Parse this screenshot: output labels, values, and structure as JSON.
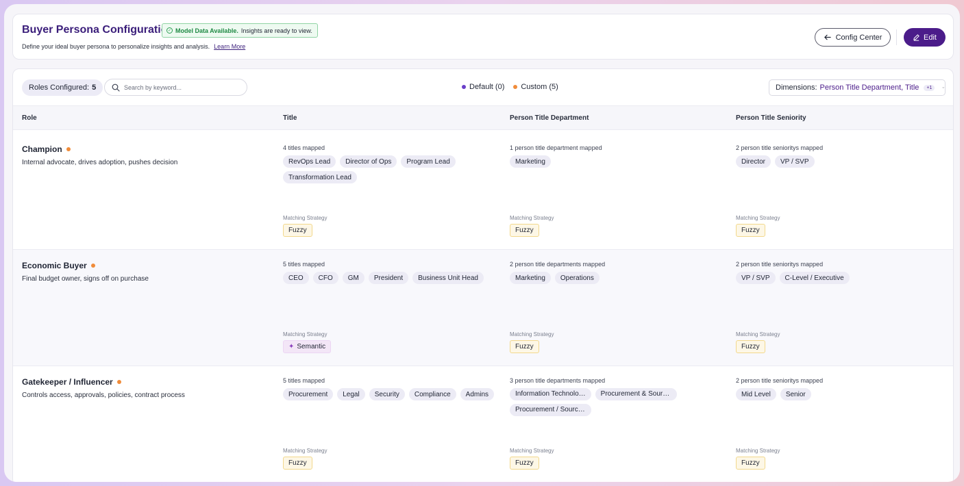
{
  "header": {
    "title": "Buyer Persona Configuration",
    "status_strong": "Model Data Available.",
    "status_text": "Insights are ready to view.",
    "subtitle": "Define your ideal buyer persona to personalize insights and analysis.",
    "learn_more": "Learn More",
    "config_center_label": "Config Center",
    "edit_label": "Edit"
  },
  "toolbar": {
    "roles_label": "Roles Configured:",
    "roles_count": "5",
    "search_placeholder": "Search by keyword...",
    "legend_default": "Default (0)",
    "legend_custom": "Custom (5)",
    "dimensions_label": "Dimensions:",
    "dimensions_value": "Person Title Department, Title",
    "dimensions_extra": "+1"
  },
  "columns": [
    "Role",
    "Title",
    "Person Title Department",
    "Person Title Seniority"
  ],
  "strategy_caption": "Matching Strategy",
  "rows": [
    {
      "name": "Champion",
      "desc": "Internal advocate, drives adoption, pushes decision",
      "title_caption": "4 titles mapped",
      "titles": [
        "RevOps Lead",
        "Director of Ops",
        "Program Lead",
        "Transformation Lead"
      ],
      "title_strategy": "Fuzzy",
      "dept_caption": "1 person title department mapped",
      "depts": [
        "Marketing"
      ],
      "dept_strategy": "Fuzzy",
      "sen_caption": "2 person title senioritys mapped",
      "seniorities": [
        "Director",
        "VP / SVP"
      ],
      "sen_strategy": "Fuzzy"
    },
    {
      "name": "Economic Buyer",
      "desc": "Final budget owner, signs off on purchase",
      "title_caption": "5 titles mapped",
      "titles": [
        "CEO",
        "CFO",
        "GM",
        "President",
        "Business Unit Head"
      ],
      "title_strategy": "Semantic",
      "dept_caption": "2 person title departments mapped",
      "depts": [
        "Marketing",
        "Operations"
      ],
      "dept_strategy": "Fuzzy",
      "sen_caption": "2 person title senioritys mapped",
      "seniorities": [
        "VP / SVP",
        "C-Level / Executive"
      ],
      "sen_strategy": "Fuzzy"
    },
    {
      "name": "Gatekeeper / Influencer",
      "desc": "Controls access, approvals, policies, contract process",
      "title_caption": "5 titles mapped",
      "titles": [
        "Procurement",
        "Legal",
        "Security",
        "Compliance",
        "Admins"
      ],
      "title_strategy": "Fuzzy",
      "dept_caption": "3 person title departments mapped",
      "depts": [
        "Information Technolo…",
        "Procurement & Sourci…",
        "Procurement / Sourci…"
      ],
      "dept_strategy": "Fuzzy",
      "sen_caption": "2 person title senioritys mapped",
      "seniorities": [
        "Mid Level",
        "Senior"
      ],
      "sen_strategy": "Fuzzy"
    }
  ],
  "colors": {
    "brand": "#4b1c8a",
    "default_dot": "#6a3fc9",
    "custom_dot": "#f08c3a",
    "status_green": "#1f8a44"
  }
}
